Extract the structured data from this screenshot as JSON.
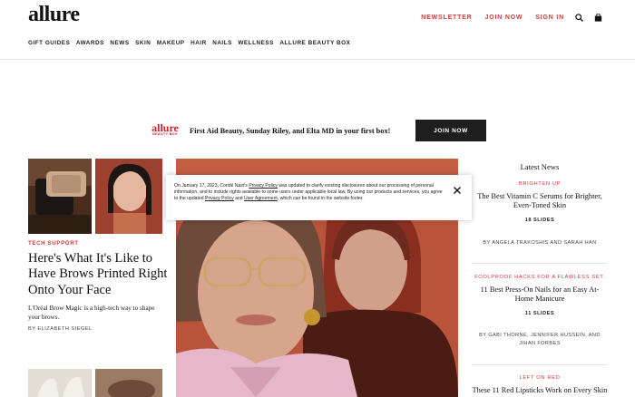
{
  "header": {
    "logo": "allure",
    "links": [
      "NEWSLETTER",
      "JOIN NOW",
      "SIGN IN"
    ],
    "nav": [
      "GIFT GUIDES",
      "AWARDS",
      "NEWS",
      "SKIN",
      "MAKEUP",
      "HAIR",
      "NAILS",
      "WELLNESS",
      "ALLURE BEAUTY BOX"
    ]
  },
  "promo": {
    "logo_main": "allure",
    "logo_sub": "BEAUTY BOX",
    "text": "First Aid Beauty, Sunday Riley, and Elta MD in your first box!",
    "button": "JOIN NOW"
  },
  "feature": {
    "kicker": "TECH SUPPORT",
    "headline": "Here's What It's Like to Have Brows Printed Right Onto Your Face",
    "dek": "L'Oréal Brow Magic is a high-tech way to shape your brows.",
    "byline": "BY ELIZABETH SIEGEL"
  },
  "latest": {
    "title": "Latest News",
    "items": [
      {
        "kicker": "BRIGHTEN UP",
        "headline": "The Best Vitamin C Serums for Brighter, Even-Toned Skin",
        "slides": "18 SLIDES",
        "byline": "BY ANGELA TRAKOSHIS AND SARAH HAN"
      },
      {
        "kicker": "FOOLPROOF HACKS FOR A FLAWLESS SET.",
        "headline": "11 Best Press-On Nails for an Easy At-Home Manicure",
        "slides": "11 SLIDES",
        "byline": "BY GABI THORNE, JENNIFER HUSSEIN, AND JIHAN FORBES"
      },
      {
        "kicker": "LEFT ON RED",
        "headline": "These 11 Red Lipsticks Work on Every Skin"
      }
    ]
  },
  "privacy": {
    "t1": "On January 17, 2023, Condé Nast's ",
    "link1": "Privacy Policy",
    "t2": " was updated to clarify existing disclosures about our processing of personal information, and to include rights available to some users under applicable local law. By using our products and services, you agree to the updated ",
    "link2": "Privacy Policy",
    "t3": " and ",
    "link3": "User Agreement",
    "t4": ", which can be found in the website footer."
  },
  "colors": {
    "accent": "#d33b3b",
    "button": "#1f1f1f",
    "promo_logo": "#c8202f"
  }
}
